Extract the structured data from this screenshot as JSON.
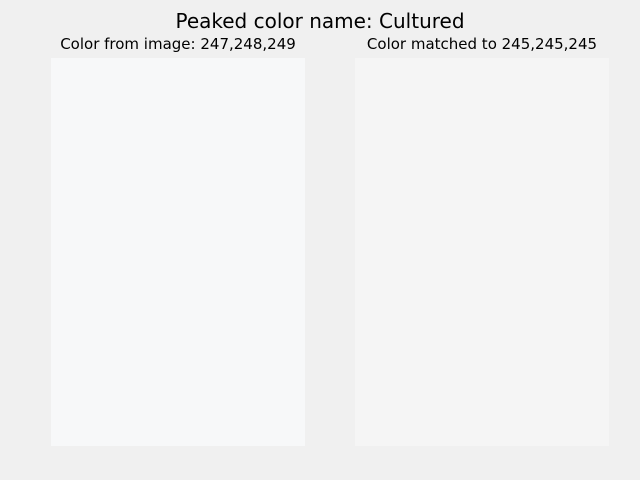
{
  "title": "Peaked color name: Cultured",
  "panels": [
    {
      "label": "Color from image: 247,248,249",
      "color": "#f7f8f9"
    },
    {
      "label": "Color matched to 245,245,245",
      "color": "#f5f5f5"
    }
  ],
  "figure_background": "#f0f0f0"
}
